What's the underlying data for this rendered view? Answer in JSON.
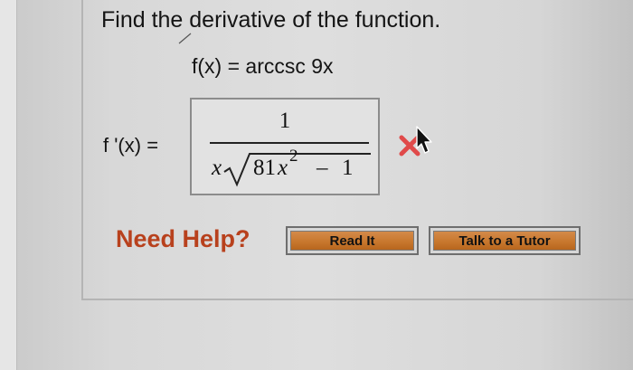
{
  "problem": {
    "question": "Find the derivative of the function.",
    "function": "f(x) = arccsc 9x"
  },
  "answer": {
    "label": "f '(x) =",
    "numerator": "1",
    "denominator": {
      "x": "x",
      "coef": "81",
      "var": "x",
      "exp": "2",
      "minus": "–",
      "one": "1"
    },
    "status_icon": "red-x-icon",
    "status_color": "#e04a4a"
  },
  "help": {
    "label": "Need Help?",
    "buttons": [
      {
        "label": "Read It"
      },
      {
        "label": "Talk to a Tutor"
      }
    ],
    "label_color": "#b8411d",
    "button_color": "#c8782e"
  }
}
